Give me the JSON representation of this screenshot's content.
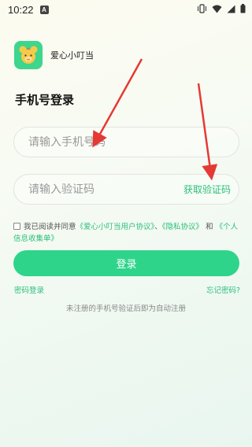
{
  "status_bar": {
    "time": "10:22",
    "notification_glyph": "A",
    "icons": [
      "vibrate-icon",
      "wifi-icon",
      "signal-icon",
      "battery-icon"
    ]
  },
  "header": {
    "app_name": "爱心小叮当",
    "logo_icon": "bear-logo-icon",
    "logo_color": "#3dd68c"
  },
  "page_title": "手机号登录",
  "form": {
    "phone": {
      "value": "",
      "placeholder": "请输入手机号码"
    },
    "code": {
      "value": "",
      "placeholder": "请输入验证码"
    },
    "get_code_label": "获取验证码"
  },
  "agreement": {
    "checked": false,
    "prefix": "我已阅读并同意",
    "user_agreement": "《爱心小叮当用户协议》",
    "separator": "、",
    "privacy_policy": "《隐私协议》",
    "and": "和",
    "personal_info": "《个人信息收集单》"
  },
  "login_button_label": "登录",
  "password_login_label": "密码登录",
  "forgot_password_label": "忘记密码?",
  "hint": "未注册的手机号验证后即为自动注册",
  "colors": {
    "accent": "#2ed48a",
    "link": "#2bbf7a",
    "annotation_arrow": "#e53935"
  }
}
